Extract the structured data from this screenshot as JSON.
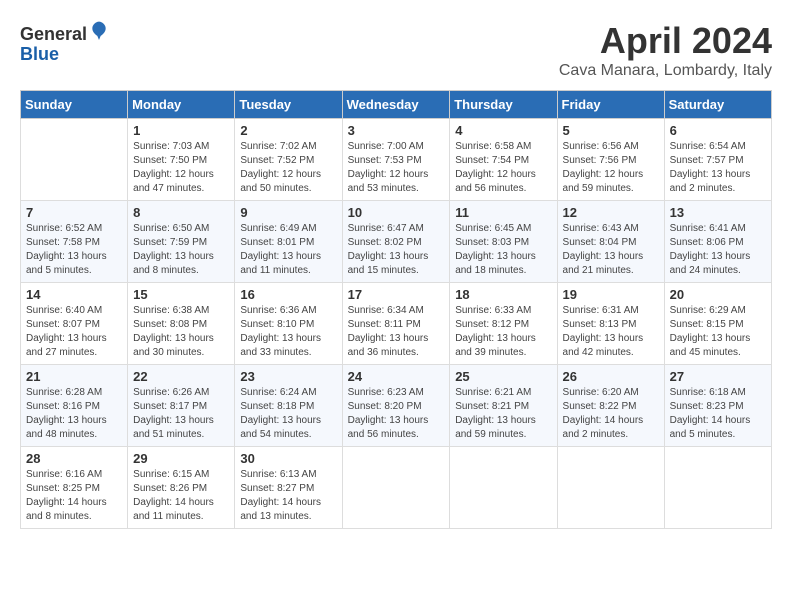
{
  "header": {
    "logo_line1": "General",
    "logo_line2": "Blue",
    "month_title": "April 2024",
    "location": "Cava Manara, Lombardy, Italy"
  },
  "days_of_week": [
    "Sunday",
    "Monday",
    "Tuesday",
    "Wednesday",
    "Thursday",
    "Friday",
    "Saturday"
  ],
  "weeks": [
    [
      {
        "day": "",
        "info": ""
      },
      {
        "day": "1",
        "info": "Sunrise: 7:03 AM\nSunset: 7:50 PM\nDaylight: 12 hours\nand 47 minutes."
      },
      {
        "day": "2",
        "info": "Sunrise: 7:02 AM\nSunset: 7:52 PM\nDaylight: 12 hours\nand 50 minutes."
      },
      {
        "day": "3",
        "info": "Sunrise: 7:00 AM\nSunset: 7:53 PM\nDaylight: 12 hours\nand 53 minutes."
      },
      {
        "day": "4",
        "info": "Sunrise: 6:58 AM\nSunset: 7:54 PM\nDaylight: 12 hours\nand 56 minutes."
      },
      {
        "day": "5",
        "info": "Sunrise: 6:56 AM\nSunset: 7:56 PM\nDaylight: 12 hours\nand 59 minutes."
      },
      {
        "day": "6",
        "info": "Sunrise: 6:54 AM\nSunset: 7:57 PM\nDaylight: 13 hours\nand 2 minutes."
      }
    ],
    [
      {
        "day": "7",
        "info": "Sunrise: 6:52 AM\nSunset: 7:58 PM\nDaylight: 13 hours\nand 5 minutes."
      },
      {
        "day": "8",
        "info": "Sunrise: 6:50 AM\nSunset: 7:59 PM\nDaylight: 13 hours\nand 8 minutes."
      },
      {
        "day": "9",
        "info": "Sunrise: 6:49 AM\nSunset: 8:01 PM\nDaylight: 13 hours\nand 11 minutes."
      },
      {
        "day": "10",
        "info": "Sunrise: 6:47 AM\nSunset: 8:02 PM\nDaylight: 13 hours\nand 15 minutes."
      },
      {
        "day": "11",
        "info": "Sunrise: 6:45 AM\nSunset: 8:03 PM\nDaylight: 13 hours\nand 18 minutes."
      },
      {
        "day": "12",
        "info": "Sunrise: 6:43 AM\nSunset: 8:04 PM\nDaylight: 13 hours\nand 21 minutes."
      },
      {
        "day": "13",
        "info": "Sunrise: 6:41 AM\nSunset: 8:06 PM\nDaylight: 13 hours\nand 24 minutes."
      }
    ],
    [
      {
        "day": "14",
        "info": "Sunrise: 6:40 AM\nSunset: 8:07 PM\nDaylight: 13 hours\nand 27 minutes."
      },
      {
        "day": "15",
        "info": "Sunrise: 6:38 AM\nSunset: 8:08 PM\nDaylight: 13 hours\nand 30 minutes."
      },
      {
        "day": "16",
        "info": "Sunrise: 6:36 AM\nSunset: 8:10 PM\nDaylight: 13 hours\nand 33 minutes."
      },
      {
        "day": "17",
        "info": "Sunrise: 6:34 AM\nSunset: 8:11 PM\nDaylight: 13 hours\nand 36 minutes."
      },
      {
        "day": "18",
        "info": "Sunrise: 6:33 AM\nSunset: 8:12 PM\nDaylight: 13 hours\nand 39 minutes."
      },
      {
        "day": "19",
        "info": "Sunrise: 6:31 AM\nSunset: 8:13 PM\nDaylight: 13 hours\nand 42 minutes."
      },
      {
        "day": "20",
        "info": "Sunrise: 6:29 AM\nSunset: 8:15 PM\nDaylight: 13 hours\nand 45 minutes."
      }
    ],
    [
      {
        "day": "21",
        "info": "Sunrise: 6:28 AM\nSunset: 8:16 PM\nDaylight: 13 hours\nand 48 minutes."
      },
      {
        "day": "22",
        "info": "Sunrise: 6:26 AM\nSunset: 8:17 PM\nDaylight: 13 hours\nand 51 minutes."
      },
      {
        "day": "23",
        "info": "Sunrise: 6:24 AM\nSunset: 8:18 PM\nDaylight: 13 hours\nand 54 minutes."
      },
      {
        "day": "24",
        "info": "Sunrise: 6:23 AM\nSunset: 8:20 PM\nDaylight: 13 hours\nand 56 minutes."
      },
      {
        "day": "25",
        "info": "Sunrise: 6:21 AM\nSunset: 8:21 PM\nDaylight: 13 hours\nand 59 minutes."
      },
      {
        "day": "26",
        "info": "Sunrise: 6:20 AM\nSunset: 8:22 PM\nDaylight: 14 hours\nand 2 minutes."
      },
      {
        "day": "27",
        "info": "Sunrise: 6:18 AM\nSunset: 8:23 PM\nDaylight: 14 hours\nand 5 minutes."
      }
    ],
    [
      {
        "day": "28",
        "info": "Sunrise: 6:16 AM\nSunset: 8:25 PM\nDaylight: 14 hours\nand 8 minutes."
      },
      {
        "day": "29",
        "info": "Sunrise: 6:15 AM\nSunset: 8:26 PM\nDaylight: 14 hours\nand 11 minutes."
      },
      {
        "day": "30",
        "info": "Sunrise: 6:13 AM\nSunset: 8:27 PM\nDaylight: 14 hours\nand 13 minutes."
      },
      {
        "day": "",
        "info": ""
      },
      {
        "day": "",
        "info": ""
      },
      {
        "day": "",
        "info": ""
      },
      {
        "day": "",
        "info": ""
      }
    ]
  ]
}
